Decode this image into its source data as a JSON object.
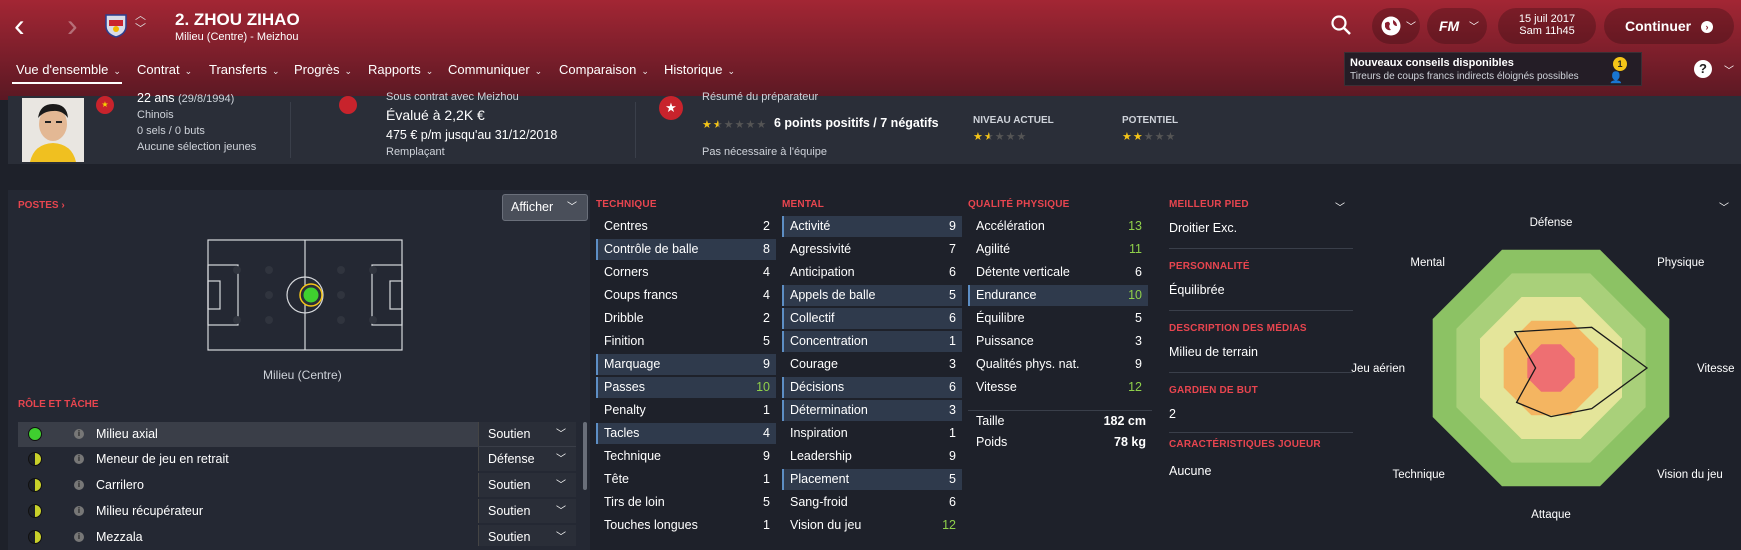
{
  "header": {
    "back_icon": "chevron-left-icon",
    "forward_icon": "chevron-right-icon",
    "player_title": "2. ZHOU ZIHAO",
    "player_subtitle": "Milieu (Centre) - Meizhou",
    "date": "15 juil 2017",
    "time": "Sam 11h45",
    "continue_label": "Continuer",
    "fm_label": "FM"
  },
  "nav": [
    {
      "label": "Vue d'ensemble"
    },
    {
      "label": "Contrat"
    },
    {
      "label": "Transferts"
    },
    {
      "label": "Progrès"
    },
    {
      "label": "Rapports"
    },
    {
      "label": "Communiquer"
    },
    {
      "label": "Comparaison"
    },
    {
      "label": "Historique"
    }
  ],
  "notification": {
    "title": "Nouveaux conseils disponibles",
    "text": "Tireurs de coups francs indirects éloignés possibles",
    "count": "1"
  },
  "help_label": "?",
  "info": {
    "age": "22 ans",
    "dob": "(29/8/1994)",
    "nationality": "Chinois",
    "caps": "0 sels / 0 buts",
    "youth": "Aucune sélection jeunes",
    "contract_label": "Sous contrat avec Meizhou",
    "value": "Évalué à 2,2K €",
    "wage": "475 € p/m jusqu'au 31/12/2018",
    "squad_status": "Remplaçant",
    "coach_label": "Résumé du préparateur",
    "coach_summary": "6 points positifs / 7 négatifs",
    "coach_stars": 1.5,
    "squad_need": "Pas nécessaire à l'équipe",
    "current_label": "NIVEAU ACTUEL",
    "current_stars": 1.5,
    "potential_label": "POTENTIEL",
    "potential_stars": 2
  },
  "positions": {
    "title": "POSTES",
    "show_label": "Afficher",
    "position_label": "Milieu (Centre)"
  },
  "roles": {
    "title": "RÔLE ET TÂCHE",
    "items": [
      {
        "name": "Milieu axial",
        "duty": "Soutien",
        "color": "#3fcf2f"
      },
      {
        "name": "Meneur de jeu en retrait",
        "duty": "Défense",
        "color": "#c9d12a"
      },
      {
        "name": "Carrilero",
        "duty": "Soutien",
        "color": "#c9d12a"
      },
      {
        "name": "Milieu récupérateur",
        "duty": "Soutien",
        "color": "#c9d12a"
      },
      {
        "name": "Mezzala",
        "duty": "Soutien",
        "color": "#c9d12a"
      }
    ]
  },
  "technique": {
    "title": "TECHNIQUE",
    "items": [
      {
        "name": "Centres",
        "value": "2"
      },
      {
        "name": "Contrôle de balle",
        "value": "8"
      },
      {
        "name": "Corners",
        "value": "4"
      },
      {
        "name": "Coups francs",
        "value": "4"
      },
      {
        "name": "Dribble",
        "value": "2"
      },
      {
        "name": "Finition",
        "value": "5"
      },
      {
        "name": "Marquage",
        "value": "9"
      },
      {
        "name": "Passes",
        "value": "10"
      },
      {
        "name": "Penalty",
        "value": "1"
      },
      {
        "name": "Tacles",
        "value": "4"
      },
      {
        "name": "Technique",
        "value": "9"
      },
      {
        "name": "Tête",
        "value": "1"
      },
      {
        "name": "Tirs de loin",
        "value": "5"
      },
      {
        "name": "Touches longues",
        "value": "1"
      }
    ]
  },
  "mental": {
    "title": "MENTAL",
    "items": [
      {
        "name": "Activité",
        "value": "9"
      },
      {
        "name": "Agressivité",
        "value": "7"
      },
      {
        "name": "Anticipation",
        "value": "6"
      },
      {
        "name": "Appels de balle",
        "value": "5"
      },
      {
        "name": "Collectif",
        "value": "6"
      },
      {
        "name": "Concentration",
        "value": "1"
      },
      {
        "name": "Courage",
        "value": "3"
      },
      {
        "name": "Décisions",
        "value": "6"
      },
      {
        "name": "Détermination",
        "value": "3"
      },
      {
        "name": "Inspiration",
        "value": "1"
      },
      {
        "name": "Leadership",
        "value": "9"
      },
      {
        "name": "Placement",
        "value": "5"
      },
      {
        "name": "Sang-froid",
        "value": "6"
      },
      {
        "name": "Vision du jeu",
        "value": "12"
      }
    ]
  },
  "physical": {
    "title": "QUALITÉ PHYSIQUE",
    "items": [
      {
        "name": "Accélération",
        "value": "13"
      },
      {
        "name": "Agilité",
        "value": "11"
      },
      {
        "name": "Détente verticale",
        "value": "6"
      },
      {
        "name": "Endurance",
        "value": "10"
      },
      {
        "name": "Équilibre",
        "value": "5"
      },
      {
        "name": "Puissance",
        "value": "3"
      },
      {
        "name": "Qualités phys. nat.",
        "value": "9"
      },
      {
        "name": "Vitesse",
        "value": "12"
      }
    ],
    "height_label": "Taille",
    "height": "182 cm",
    "weight_label": "Poids",
    "weight": "78 kg"
  },
  "profile": {
    "foot_label": "MEILLEUR PIED",
    "foot": "Droitier Exc.",
    "personality_label": "PERSONNALITÉ",
    "personality": "Équilibrée",
    "media_label": "DESCRIPTION DES MÉDIAS",
    "media": "Milieu de terrain",
    "gk_label": "GARDIEN DE BUT",
    "gk": "2",
    "traits_label": "CARACTÉRISTIQUES JOUEUR",
    "traits": "Aucune"
  },
  "radar": {
    "labels": [
      "Défense",
      "Physique",
      "Vitesse",
      "Vision du jeu",
      "Attaque",
      "Technique",
      "Jeu aérien",
      "Mental"
    ],
    "values": [
      0.3,
      0.45,
      0.75,
      0.45,
      0.38,
      0.38,
      0.12,
      0.4
    ]
  }
}
